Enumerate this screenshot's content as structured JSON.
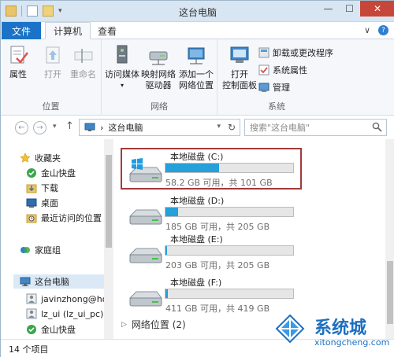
{
  "window": {
    "title": "这台电脑"
  },
  "qat": {
    "arrow": "▾"
  },
  "window_controls": {
    "minimize": "—",
    "maximize": "☐",
    "close": "✕"
  },
  "tabs": {
    "file": "文件",
    "computer": "计算机",
    "view": "查看"
  },
  "tab_controls": {
    "collapse": "∨",
    "help": "?"
  },
  "ribbon": {
    "location_group": {
      "label": "位置",
      "properties": "属性",
      "open": "打开",
      "rename": "重命名"
    },
    "network_group": {
      "label": "网络",
      "access_media": "访问媒体",
      "map_drive_1": "映射网络",
      "map_drive_2": "驱动器",
      "add_location_1": "添加一个",
      "add_location_2": "网络位置",
      "caret": "▾"
    },
    "system_group": {
      "label": "系统",
      "control_panel_1": "打开",
      "control_panel_2": "控制面板",
      "uninstall": "卸载或更改程序",
      "system_props": "系统属性",
      "manage": "管理"
    }
  },
  "address": {
    "back": "←",
    "forward": "→",
    "recent": "▾",
    "up": "↑",
    "path": "这台电脑",
    "sep": "›",
    "caret": "▾",
    "refresh": "↻",
    "search_placeholder": "搜索\"这台电脑\""
  },
  "nav": {
    "favorites": "收藏夹",
    "jinshan": "金山快盘",
    "downloads": "下载",
    "desktop": "桌面",
    "recent": "最近访问的位置",
    "homegroup": "家庭组",
    "this_pc": "这台电脑",
    "user1": "javinzhong@ho",
    "user2": "lz_ui (lz_ui_pc)",
    "jinshan2": "金山快盘"
  },
  "drives": [
    {
      "name": "本地磁盘 (C:)",
      "space": "58.2 GB 可用，共 101 GB",
      "used_fraction": 0.42
    },
    {
      "name": "本地磁盘 (D:)",
      "space": "185 GB 可用，共 205 GB",
      "used_fraction": 0.1
    },
    {
      "name": "本地磁盘 (E:)",
      "space": "203 GB 可用，共 205 GB",
      "used_fraction": 0.01
    },
    {
      "name": "本地磁盘 (F:)",
      "space": "411 GB 可用，共 419 GB",
      "used_fraction": 0.02
    }
  ],
  "network_locations": {
    "label": "网络位置 (2)",
    "chevron": "▷"
  },
  "status": {
    "items": "14 个项目"
  },
  "watermark": {
    "name": "系统城",
    "url": "xitongcheng.com"
  },
  "colors": {
    "file_tab": "#1a73c7",
    "progress_fill": "#26a0da",
    "highlight": "#a33a3a"
  }
}
